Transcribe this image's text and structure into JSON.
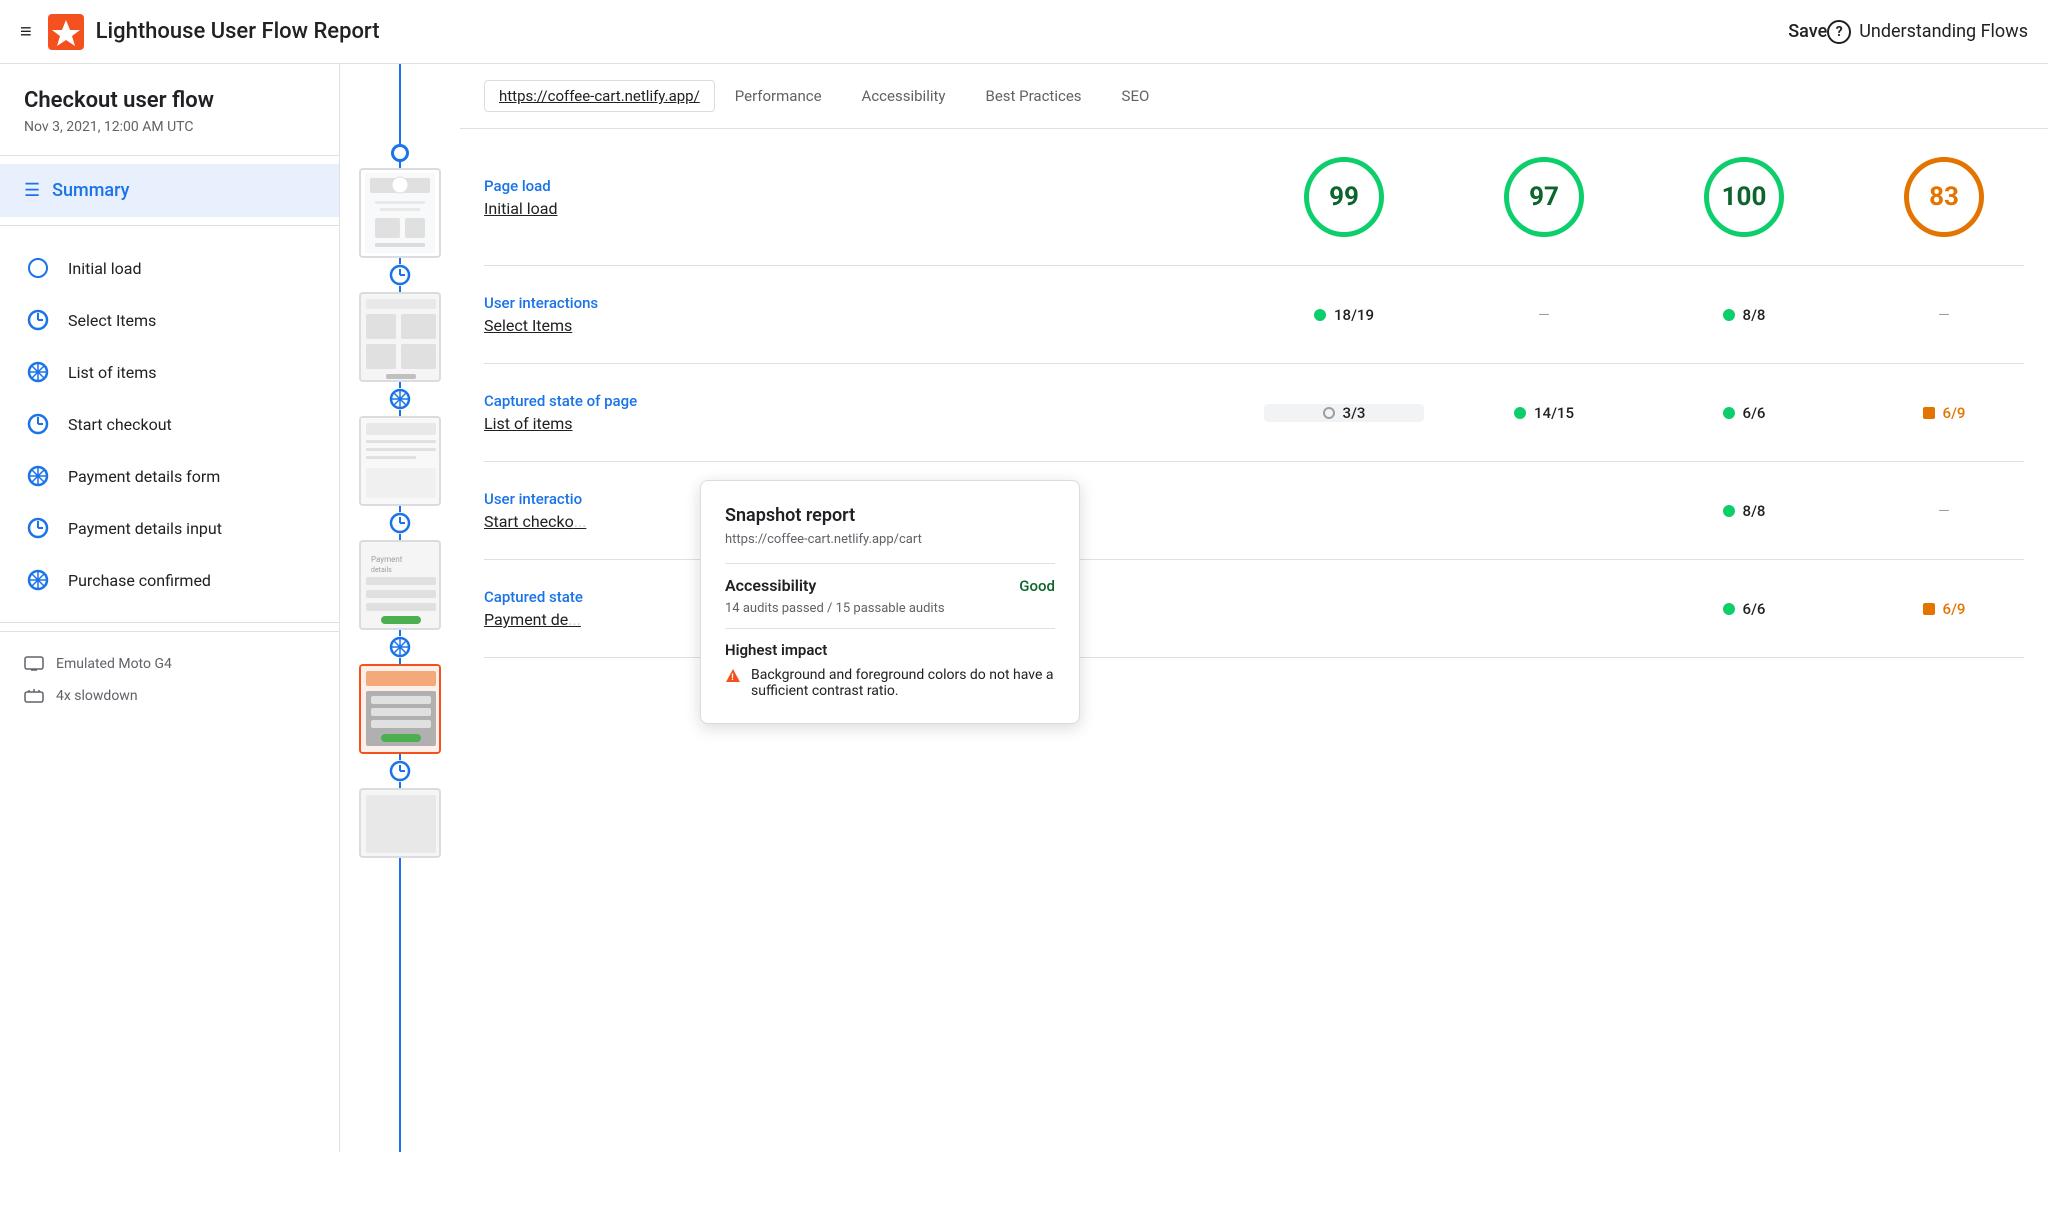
{
  "topbar": {
    "menu_icon": "≡",
    "title": "Lighthouse User Flow Report",
    "save_label": "Save",
    "help_label": "Understanding Flows",
    "help_icon": "?"
  },
  "sidebar": {
    "flow_title": "Checkout user flow",
    "date": "Nov 3, 2021, 12:00 AM UTC",
    "summary_label": "Summary",
    "steps": [
      {
        "label": "Initial load",
        "type": "circle"
      },
      {
        "label": "Select Items",
        "type": "clock"
      },
      {
        "label": "List of items",
        "type": "snowflake"
      },
      {
        "label": "Start checkout",
        "type": "clock"
      },
      {
        "label": "Payment details form",
        "type": "snowflake"
      },
      {
        "label": "Payment details input",
        "type": "clock"
      },
      {
        "label": "Purchase confirmed",
        "type": "snowflake"
      }
    ],
    "footer_items": [
      {
        "label": "Emulated Moto G4",
        "icon": "device"
      },
      {
        "label": "4x slowdown",
        "icon": "speed"
      }
    ]
  },
  "content": {
    "url": "https://coffee-cart.netlify.app/",
    "tabs": [
      "Performance",
      "Accessibility",
      "Best Practices",
      "SEO"
    ],
    "rows": [
      {
        "category": "Page load",
        "name": "Initial load",
        "metrics": [
          {
            "type": "circle",
            "value": "99",
            "color": "green"
          },
          {
            "type": "circle",
            "value": "97",
            "color": "green"
          },
          {
            "type": "circle",
            "value": "100",
            "color": "green"
          },
          {
            "type": "circle",
            "value": "83",
            "color": "orange"
          }
        ]
      },
      {
        "category": "User interactions",
        "name": "Select Items",
        "metrics": [
          {
            "type": "badge",
            "value": "18/19",
            "dot": "green"
          },
          {
            "type": "dash"
          },
          {
            "type": "badge",
            "value": "8/8",
            "dot": "green"
          },
          {
            "type": "dash"
          }
        ]
      },
      {
        "category": "Captured state of page",
        "name": "List of items",
        "highlighted_col": 0,
        "metrics": [
          {
            "type": "badge",
            "value": "3/3",
            "dot": "gray-empty"
          },
          {
            "type": "badge",
            "value": "14/15",
            "dot": "green"
          },
          {
            "type": "badge",
            "value": "6/6",
            "dot": "green"
          },
          {
            "type": "badge",
            "value": "6/9",
            "dot": "orange"
          }
        ]
      },
      {
        "category": "User interactions",
        "name": "Start checkout",
        "partial": true,
        "metrics": [
          {
            "type": "hidden"
          },
          {
            "type": "hidden"
          },
          {
            "type": "badge",
            "value": "8/8",
            "dot": "green"
          },
          {
            "type": "dash"
          }
        ]
      },
      {
        "category": "Captured state",
        "name": "Payment de...",
        "partial": true,
        "metrics": [
          {
            "type": "hidden"
          },
          {
            "type": "hidden"
          },
          {
            "type": "badge",
            "value": "6/6",
            "dot": "green"
          },
          {
            "type": "badge",
            "value": "6/9",
            "dot": "orange"
          }
        ]
      }
    ]
  },
  "tooltip": {
    "title": "Snapshot report",
    "url": "https://coffee-cart.netlify.app/cart",
    "metric_label": "Accessibility",
    "metric_value": "Good",
    "metric_sub": "14 audits passed / 15 passable audits",
    "impact_title": "Highest impact",
    "impact_items": [
      "Background and foreground colors do not have a sufficient contrast ratio."
    ]
  }
}
